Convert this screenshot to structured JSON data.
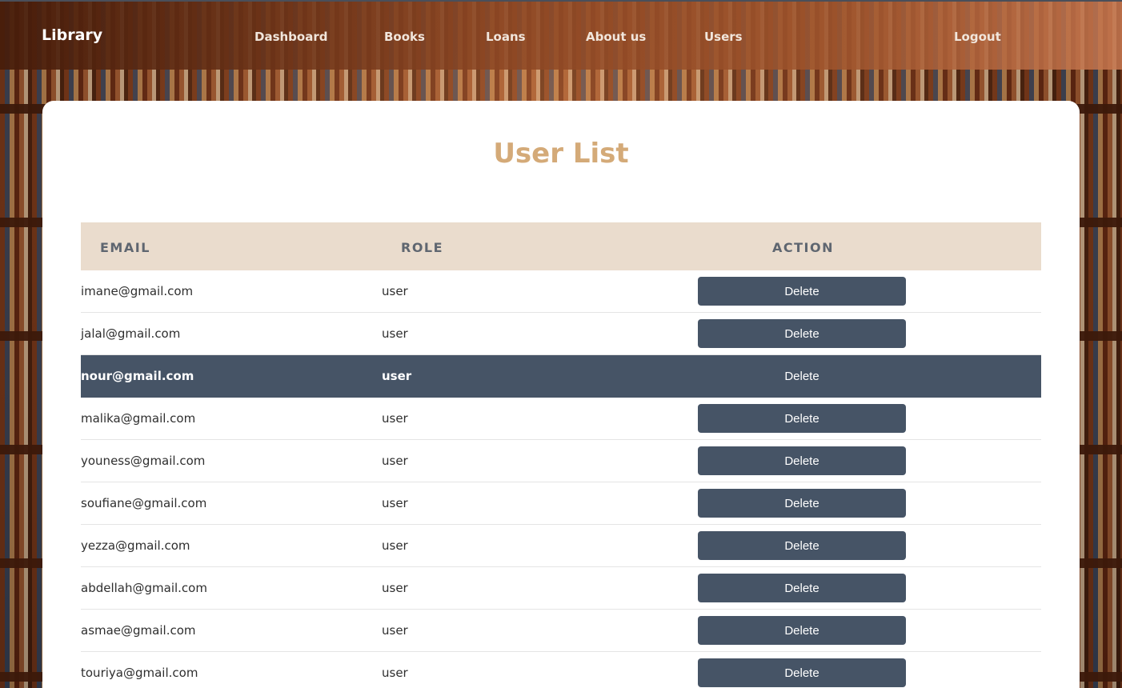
{
  "navbar": {
    "brand": "Library",
    "links": [
      "Dashboard",
      "Books",
      "Loans",
      "About us",
      "Users"
    ],
    "logout": "Logout"
  },
  "page": {
    "title": "User List"
  },
  "table": {
    "headers": {
      "email": "EMAIL",
      "role": "ROLE",
      "action": "ACTION"
    },
    "rows": [
      {
        "email": "imane@gmail.com",
        "role": "user",
        "action": "Delete"
      },
      {
        "email": "jalal@gmail.com",
        "role": "user",
        "action": "Delete"
      },
      {
        "email": "nour@gmail.com",
        "role": "user",
        "action": "Delete"
      },
      {
        "email": "malika@gmail.com",
        "role": "user",
        "action": "Delete"
      },
      {
        "email": "youness@gmail.com",
        "role": "user",
        "action": "Delete"
      },
      {
        "email": "soufiane@gmail.com",
        "role": "user",
        "action": "Delete"
      },
      {
        "email": "yezza@gmail.com",
        "role": "user",
        "action": "Delete"
      },
      {
        "email": "abdellah@gmail.com",
        "role": "user",
        "action": "Delete"
      },
      {
        "email": "asmae@gmail.com",
        "role": "user",
        "action": "Delete"
      },
      {
        "email": "touriya@gmail.com",
        "role": "user",
        "action": "Delete"
      }
    ],
    "highlighted_row": 2
  },
  "colors": {
    "accent": "#d4aa78",
    "button": "#465466",
    "header_bg": "#eadccd"
  }
}
